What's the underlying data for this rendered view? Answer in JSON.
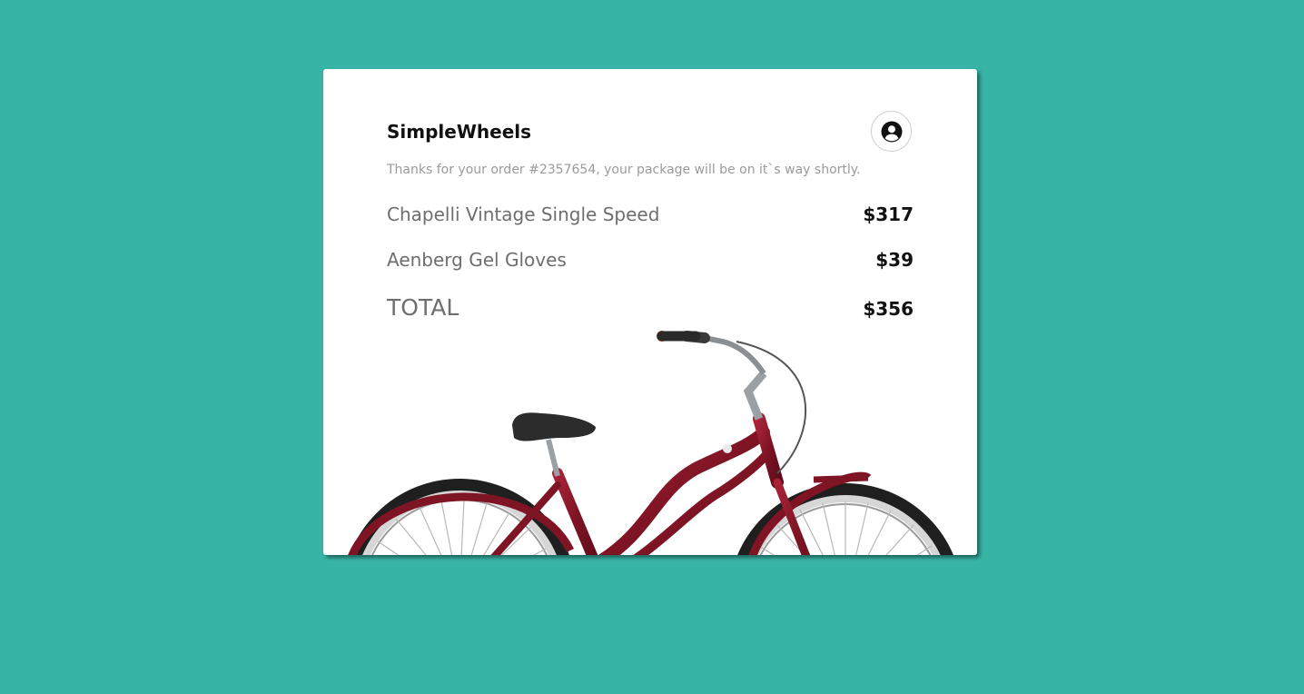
{
  "brand": "SimpleWheels",
  "account_icon": "user-circle-icon",
  "message": "Thanks for your order #2357654, your package will be on it`s way shortly.",
  "items": [
    {
      "name": "Chapelli Vintage Single Speed",
      "price": "$317"
    },
    {
      "name": "Aenberg Gel Gloves",
      "price": "$39"
    }
  ],
  "total": {
    "label": "TOTAL",
    "price": "$356"
  },
  "colors": {
    "background": "#38b4a6",
    "card": "#ffffff",
    "bike_frame": "#8b1a2b"
  },
  "image": "bicycle"
}
